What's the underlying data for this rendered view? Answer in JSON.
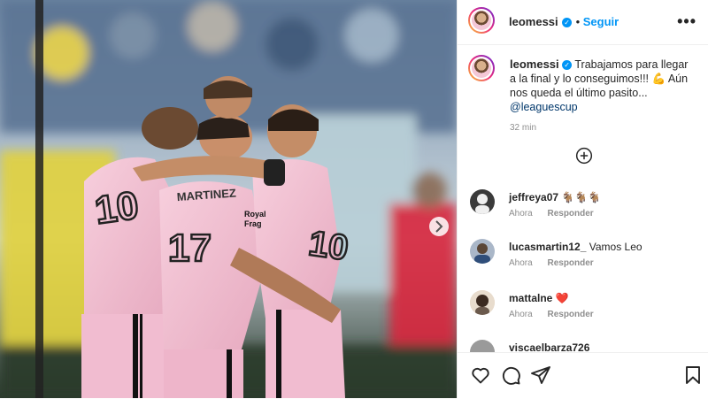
{
  "post": {
    "username": "leomessi",
    "follow_label": "Seguir",
    "more_icon": "more-horizontal-icon",
    "caption": {
      "text": "Trabajamos para llegar a la final y lo conseguimos!!! 💪 Aún nos queda el último pasito...",
      "mention": "@leaguescup",
      "time": "32 min"
    }
  },
  "comments": [
    {
      "username": "jeffreya07",
      "text": "🐐🐐🐐",
      "time": "Ahora",
      "reply_label": "Responder"
    },
    {
      "username": "lucasmartin12_",
      "text": "Vamos Leo",
      "time": "Ahora",
      "reply_label": "Responder"
    },
    {
      "username": "mattalne",
      "text": "❤️",
      "time": "Ahora",
      "reply_label": "Responder"
    },
    {
      "username": "viscaelbarza726",
      "text": "",
      "time": "",
      "reply_label": ""
    }
  ],
  "photo": {
    "jersey_numbers": [
      "10",
      "17",
      "10"
    ],
    "jersey_name": "MARTINEZ",
    "sponsor_lines": [
      "Royal",
      "Frag"
    ]
  },
  "colors": {
    "accent_blue": "#0095f6",
    "jersey_pink": "#f3bfd2",
    "heart_red": "#ed4956"
  }
}
